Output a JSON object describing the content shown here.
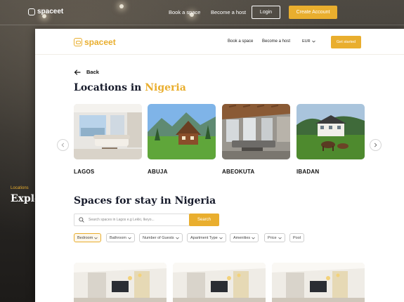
{
  "background": {
    "logo_text": "spaceet",
    "nav": {
      "book_label": "Book a space",
      "host_label": "Become a host",
      "login_label": "Login",
      "create_label": "Create Account"
    },
    "hero": {
      "eyebrow": "Locations",
      "headline": "Explo"
    }
  },
  "window": {
    "logo_text": "spaceet",
    "nav": {
      "book_label": "Book a space",
      "host_label": "Become a host",
      "currency_label": "EUR",
      "cta_label": "Get started"
    },
    "back_label": "Back",
    "locations_title": {
      "prefix": "Locations in ",
      "accent": "Nigeria"
    },
    "locations": [
      {
        "name": "LAGOS"
      },
      {
        "name": "ABUJA"
      },
      {
        "name": "ABEOKUTA"
      },
      {
        "name": "IBADAN"
      }
    ],
    "spaces_title": "Spaces  for stay in Nigeria",
    "search": {
      "placeholder": "Search spaces in Lagos e.g Lekki, Ikeyo...",
      "button_label": "Search"
    },
    "filters": [
      {
        "label": "Bedroom",
        "has_chevron": true,
        "active": true
      },
      {
        "label": "Bathroom",
        "has_chevron": true,
        "active": false
      },
      {
        "label": "Number of Guests",
        "has_chevron": true,
        "active": false
      },
      {
        "label": "Apartment Type",
        "has_chevron": true,
        "active": false
      },
      {
        "label": "Amenities",
        "has_chevron": true,
        "active": false
      },
      {
        "label": "Price",
        "has_chevron": true,
        "active": false
      },
      {
        "label": "Pool",
        "has_chevron": false,
        "active": false
      }
    ],
    "colors": {
      "accent": "#e9ae2e",
      "heading": "#161a2a"
    }
  }
}
